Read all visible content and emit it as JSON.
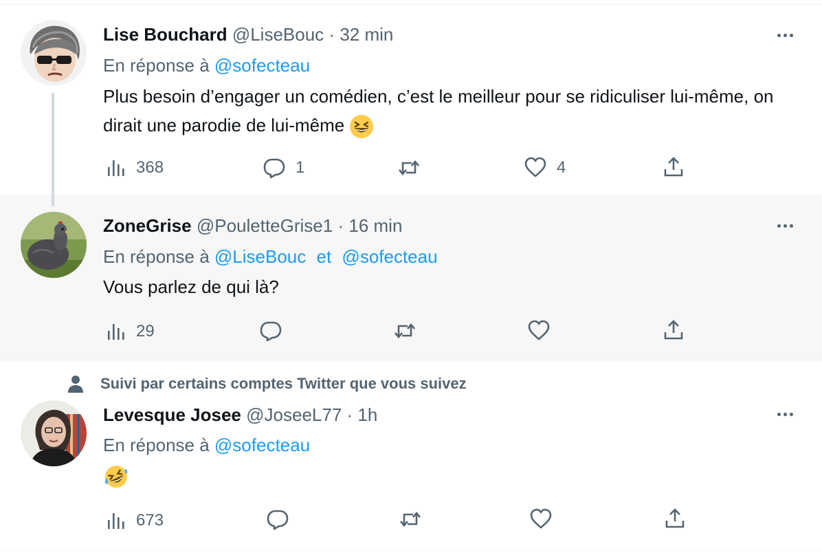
{
  "tweets": [
    {
      "name": "Lise Bouchard",
      "handle": "@LiseBouc",
      "sep": "·",
      "time": "32 min",
      "reply_prefix": "En réponse à",
      "mentions": [
        "@sofecteau"
      ],
      "text": "Plus besoin d’engager un comédien, c’est le meilleur pour se ridiculiser lui-même, on dirait une parodie de lui-même",
      "emoji": "grinning-squinting-face",
      "views": "368",
      "replies": "1",
      "retweets": "",
      "likes": "4"
    },
    {
      "name": "ZoneGrise",
      "handle": "@PouletteGrise1",
      "sep": "·",
      "time": "16 min",
      "reply_prefix": "En réponse à",
      "mentions": [
        "@LiseBouc",
        "@sofecteau"
      ],
      "conjunction": "et",
      "text": "Vous parlez de qui là?",
      "views": "29",
      "replies": "",
      "retweets": "",
      "likes": ""
    },
    {
      "social_context": "Suivi par certains comptes Twitter que vous suivez",
      "name": "Levesque Josee",
      "handle": "@JoseeL77",
      "sep": "·",
      "time": "1h",
      "reply_prefix": "En réponse à",
      "mentions": [
        "@sofecteau"
      ],
      "emoji": "rolling-on-the-floor-laughing",
      "views": "673",
      "replies": "",
      "retweets": "",
      "likes": ""
    }
  ],
  "colors": {
    "text": "#0f1419",
    "secondary": "#536471",
    "accent": "#1d9bf0",
    "hover_bg": "#f7f7f7"
  }
}
